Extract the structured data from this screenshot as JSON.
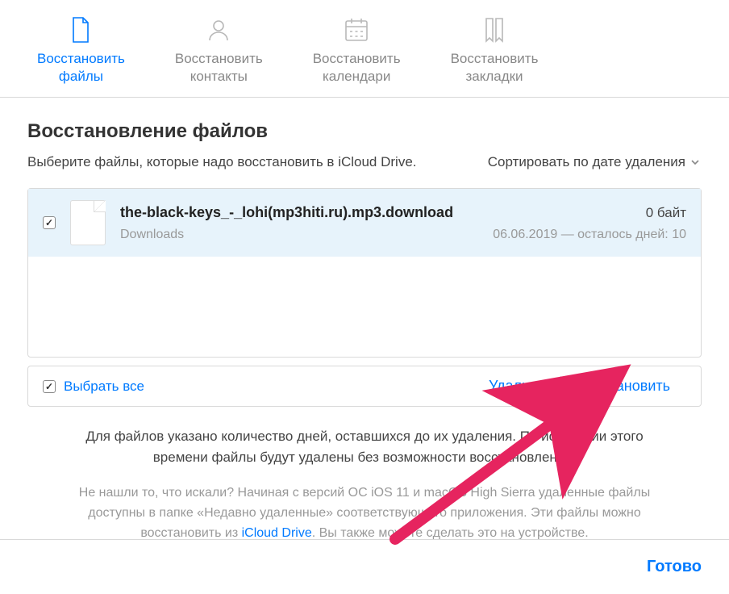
{
  "tabs": [
    {
      "label_line1": "Восстановить",
      "label_line2": "файлы",
      "active": true
    },
    {
      "label_line1": "Восстановить",
      "label_line2": "контакты",
      "active": false
    },
    {
      "label_line1": "Восстановить",
      "label_line2": "календари",
      "active": false
    },
    {
      "label_line1": "Восстановить",
      "label_line2": "закладки",
      "active": false
    }
  ],
  "heading": "Восстановление файлов",
  "subtitle": "Выберите файлы, которые надо восстановить в iCloud Drive.",
  "sort_label": "Сортировать по дате удаления",
  "file": {
    "name": "the-black-keys_-_lohi(mp3hiti.ru).mp3.download",
    "size": "0 байт",
    "location": "Downloads",
    "expiry": "06.06.2019 — осталось дней: 10"
  },
  "select_all_label": "Выбрать все",
  "delete_label": "Удалить",
  "restore_label": "Восстановить",
  "info_text": "Для файлов указано количество дней, оставшихся до их удаления. По истечении этого времени файлы будут удалены без возможности восстановления.",
  "note_prefix": "Не нашли то, что искали? Начиная с версий ОС iOS 11 и macOS High Sierra удаленные файлы доступны в папке «Недавно удаленные» соответствующего приложения. Эти файлы можно восстановить из ",
  "note_link": "iCloud Drive",
  "note_suffix": ". Вы также можете сделать это на устройстве.",
  "done_label": "Готово",
  "colors": {
    "accent": "#007aff",
    "selected_bg": "#e7f3fb",
    "arrow": "#e6245f"
  }
}
